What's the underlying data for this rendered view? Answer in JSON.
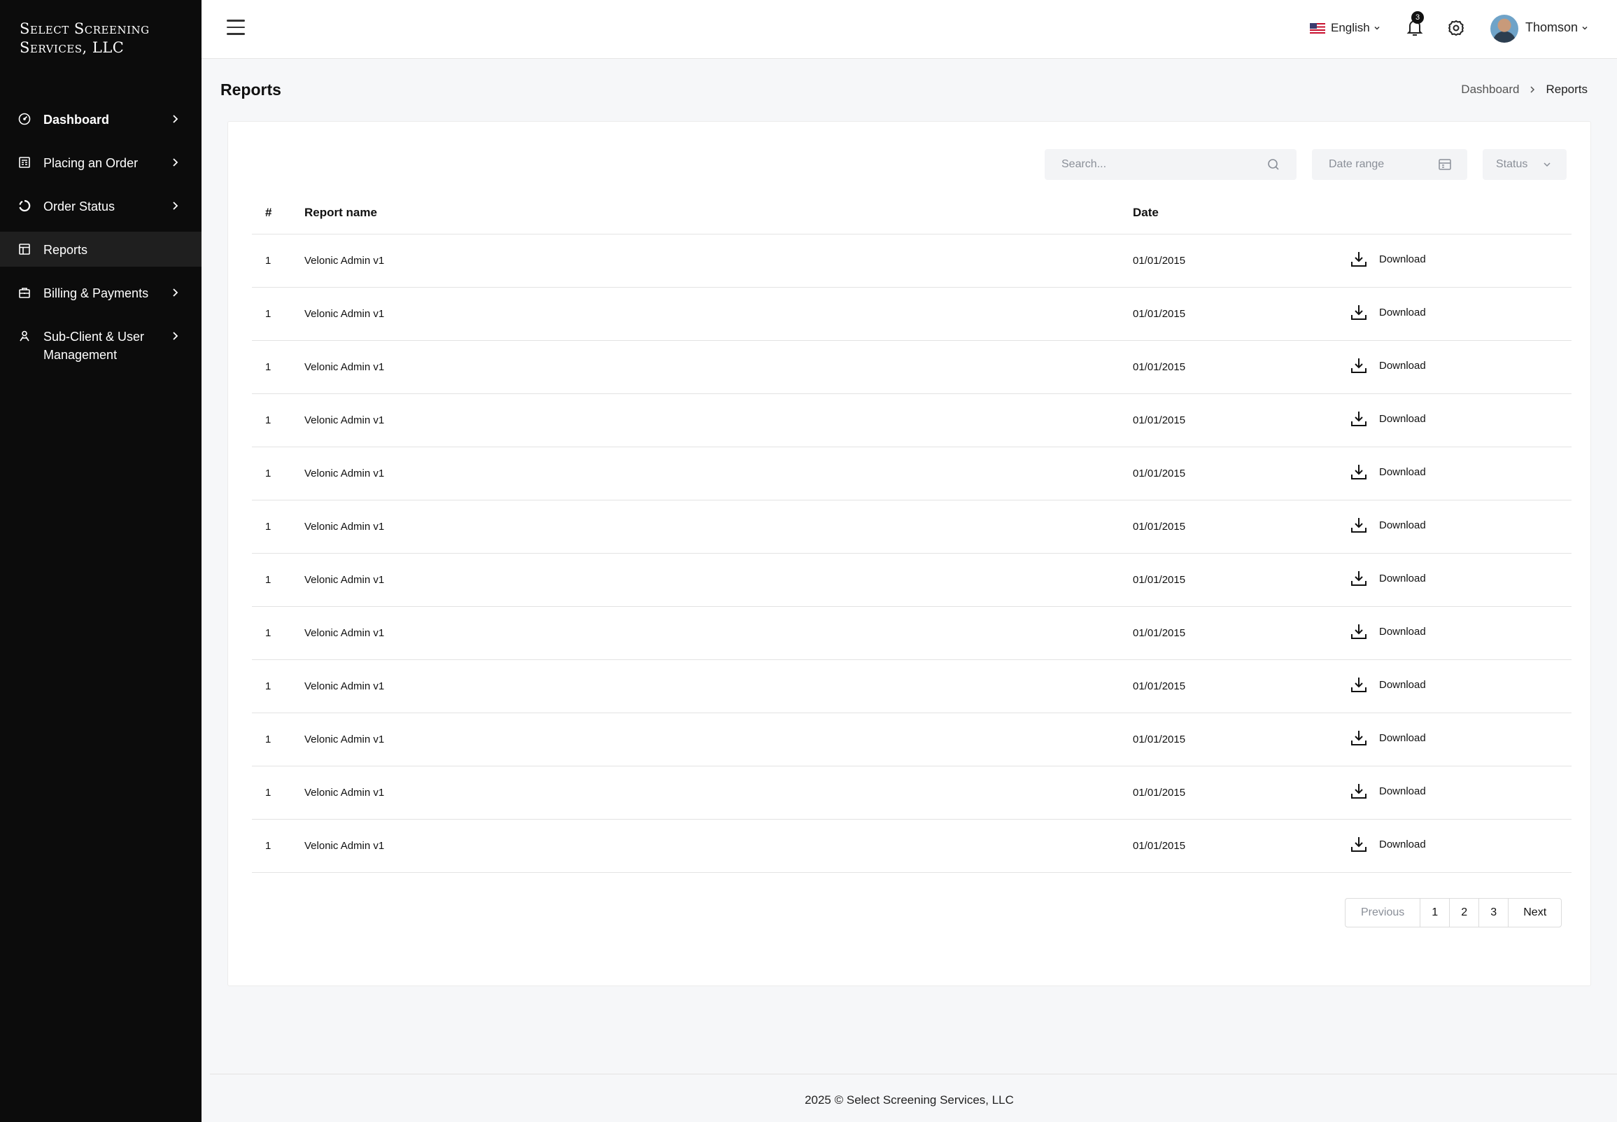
{
  "brand": {
    "line1": "Select Screening",
    "line2": "Services, LLC"
  },
  "sidebar": {
    "items": [
      {
        "label": "Dashboard",
        "icon": "gauge-icon",
        "chevron": true
      },
      {
        "label": "Placing an Order",
        "icon": "order-form-icon",
        "chevron": true
      },
      {
        "label": "Order Status",
        "icon": "status-circle-icon",
        "chevron": true
      },
      {
        "label": "Reports",
        "icon": "report-layout-icon",
        "chevron": false,
        "active": true
      },
      {
        "label": "Billing & Payments",
        "icon": "briefcase-icon",
        "chevron": true
      },
      {
        "label": "Sub-Client & User Management",
        "icon": "user-management-icon",
        "chevron": true
      }
    ]
  },
  "topbar": {
    "language": "English",
    "notifications_count": "3",
    "user_name": "Thomson"
  },
  "page": {
    "title": "Reports",
    "breadcrumb": {
      "parent": "Dashboard",
      "current": "Reports"
    }
  },
  "filters": {
    "search_placeholder": "Search...",
    "date_range_placeholder": "Date range",
    "status_placeholder": "Status"
  },
  "table": {
    "headers": {
      "num": "#",
      "name": "Report name",
      "date": "Date"
    },
    "rows": [
      {
        "num": "1",
        "name": "Velonic Admin v1",
        "date": "01/01/2015",
        "action": "Download"
      },
      {
        "num": "1",
        "name": "Velonic Admin v1",
        "date": "01/01/2015",
        "action": "Download"
      },
      {
        "num": "1",
        "name": "Velonic Admin v1",
        "date": "01/01/2015",
        "action": "Download"
      },
      {
        "num": "1",
        "name": "Velonic Admin v1",
        "date": "01/01/2015",
        "action": "Download"
      },
      {
        "num": "1",
        "name": "Velonic Admin v1",
        "date": "01/01/2015",
        "action": "Download"
      },
      {
        "num": "1",
        "name": "Velonic Admin v1",
        "date": "01/01/2015",
        "action": "Download"
      },
      {
        "num": "1",
        "name": "Velonic Admin v1",
        "date": "01/01/2015",
        "action": "Download"
      },
      {
        "num": "1",
        "name": "Velonic Admin v1",
        "date": "01/01/2015",
        "action": "Download"
      },
      {
        "num": "1",
        "name": "Velonic Admin v1",
        "date": "01/01/2015",
        "action": "Download"
      },
      {
        "num": "1",
        "name": "Velonic Admin v1",
        "date": "01/01/2015",
        "action": "Download"
      },
      {
        "num": "1",
        "name": "Velonic Admin v1",
        "date": "01/01/2015",
        "action": "Download"
      },
      {
        "num": "1",
        "name": "Velonic Admin v1",
        "date": "01/01/2015",
        "action": "Download"
      }
    ]
  },
  "pagination": {
    "previous": "Previous",
    "pages": [
      "1",
      "2",
      "3"
    ],
    "next": "Next"
  },
  "footer": {
    "text": "2025 © Select Screening Services, LLC"
  }
}
